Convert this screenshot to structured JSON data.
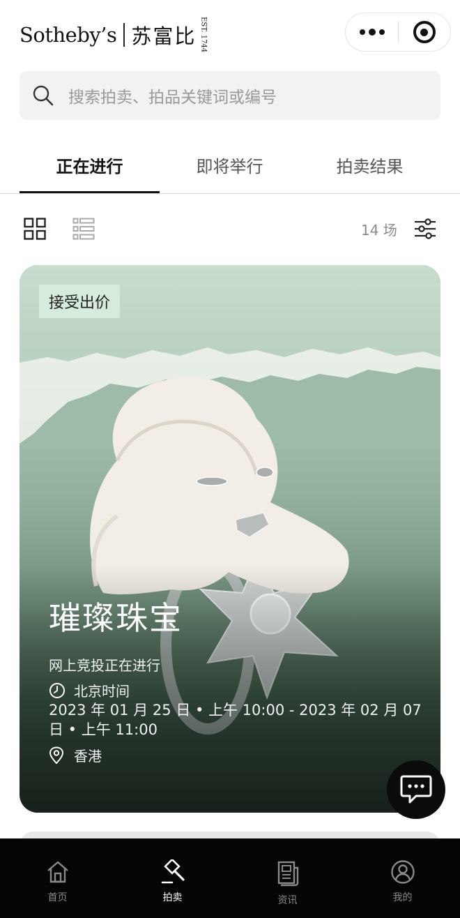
{
  "header": {
    "brand_en": "Sotheby’s",
    "brand_cn": "苏富比",
    "brand_est": "EST. 1744"
  },
  "search": {
    "placeholder": "搜索拍卖、拍品关键词或编号"
  },
  "tabs": [
    {
      "label": "正在进行",
      "active": true
    },
    {
      "label": "即将举行",
      "active": false
    },
    {
      "label": "拍卖结果",
      "active": false
    }
  ],
  "view": {
    "count": "14 场"
  },
  "auction": {
    "badge": "接受出价",
    "title": "璀璨珠宝",
    "status": "网上竞投正在进行",
    "timezone": "北京时间",
    "dates": "2023 年 01 月 25 日 • 上午 10:00 - 2023 年 02 月 07 日 • 上午 11:00",
    "location": "香港"
  },
  "nav": [
    {
      "label": "首页",
      "icon": "home-icon",
      "active": false
    },
    {
      "label": "拍卖",
      "icon": "gavel-icon",
      "active": true
    },
    {
      "label": "资讯",
      "icon": "news-icon",
      "active": false
    },
    {
      "label": "我的",
      "icon": "profile-icon",
      "active": false
    }
  ],
  "colors": {
    "accent": "#111111",
    "badge_bg": "#d7ebdc",
    "nav_bg": "#050505"
  }
}
